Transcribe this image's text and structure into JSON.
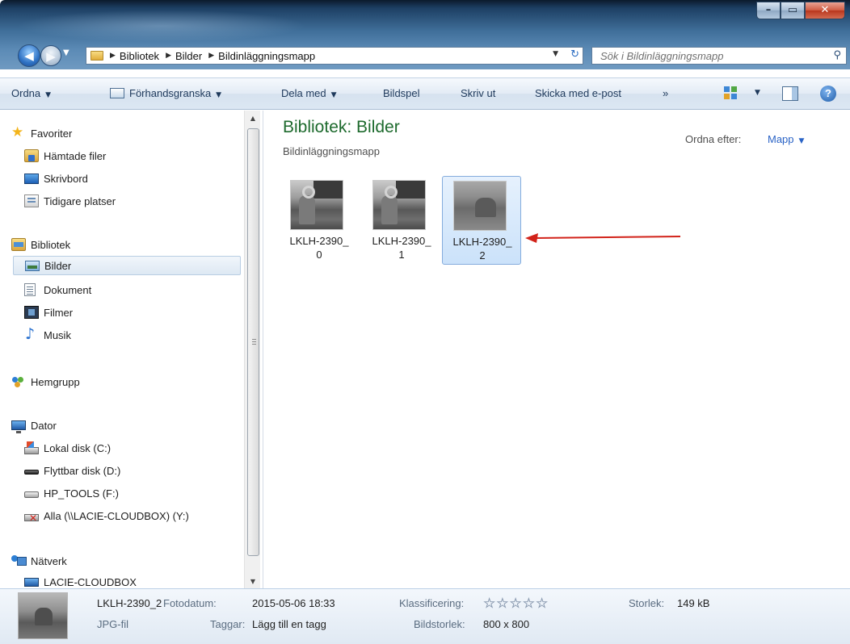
{
  "window": {
    "buttons": {
      "minimize": "–",
      "maximize": "▭",
      "close": "✕"
    }
  },
  "nav": {
    "back": "◀",
    "forward": "▶",
    "recent": "▼",
    "breadcrumb": [
      "Bibliotek",
      "Bilder",
      "Bildinläggningsmapp"
    ],
    "separator": "▶",
    "address_dropdown": "▼",
    "refresh": "↻",
    "search_placeholder": "Sök i Bildinläggningsmapp",
    "search_icon": "⚲"
  },
  "toolbar": {
    "organize": "Ordna",
    "preview": "Förhandsgranska",
    "share": "Dela med",
    "slideshow": "Bildspel",
    "print": "Skriv ut",
    "email": "Skicka med e-post",
    "more": "»",
    "caret": "▼",
    "help": "?"
  },
  "sidebar": {
    "favorites": {
      "label": "Favoriter",
      "items": [
        "Hämtade filer",
        "Skrivbord",
        "Tidigare platser"
      ]
    },
    "libraries": {
      "label": "Bibliotek",
      "items": [
        "Bilder",
        "Dokument",
        "Filmer",
        "Musik"
      ],
      "selected": "Bilder"
    },
    "homegroup": {
      "label": "Hemgrupp"
    },
    "computer": {
      "label": "Dator",
      "items": [
        "Lokal disk (C:)",
        "Flyttbar disk (D:)",
        "HP_TOOLS (F:)",
        "Alla (\\\\LACIE-CLOUDBOX) (Y:)"
      ]
    },
    "network": {
      "label": "Nätverk",
      "items": [
        "LACIE-CLOUDBOX"
      ]
    },
    "scroll_up": "▲",
    "scroll_down": "▼"
  },
  "content": {
    "title": "Bibliotek: Bilder",
    "subtitle": "Bildinläggningsmapp",
    "arrange_label": "Ordna efter:",
    "arrange_value": "Mapp",
    "files": [
      {
        "line1": "LKLH-2390_",
        "line2": "0",
        "selected": false
      },
      {
        "line1": "LKLH-2390_",
        "line2": "1",
        "selected": false
      },
      {
        "line1": "LKLH-2390_",
        "line2": "2",
        "selected": true
      }
    ],
    "annotation_arrow_color": "#d2231a"
  },
  "details": {
    "name": "LKLH-2390_2",
    "type": "JPG-fil",
    "photo_date_label": "Fotodatum:",
    "photo_date_value": "2015-05-06 18:33",
    "tags_label": "Taggar:",
    "tags_value": "Lägg till en tagg",
    "rating_label": "Klassificering:",
    "rating_stars": "☆☆☆☆☆",
    "rating_value": 0,
    "dimensions_label": "Bildstorlek:",
    "dimensions_value": "800 x 800",
    "size_label": "Storlek:",
    "size_value": "149 kB"
  },
  "colors": {
    "title_green": "#1d6a2d",
    "link_blue": "#2a63c6",
    "selection_fill": "#cbe2fa",
    "selection_border": "#84acdd"
  }
}
